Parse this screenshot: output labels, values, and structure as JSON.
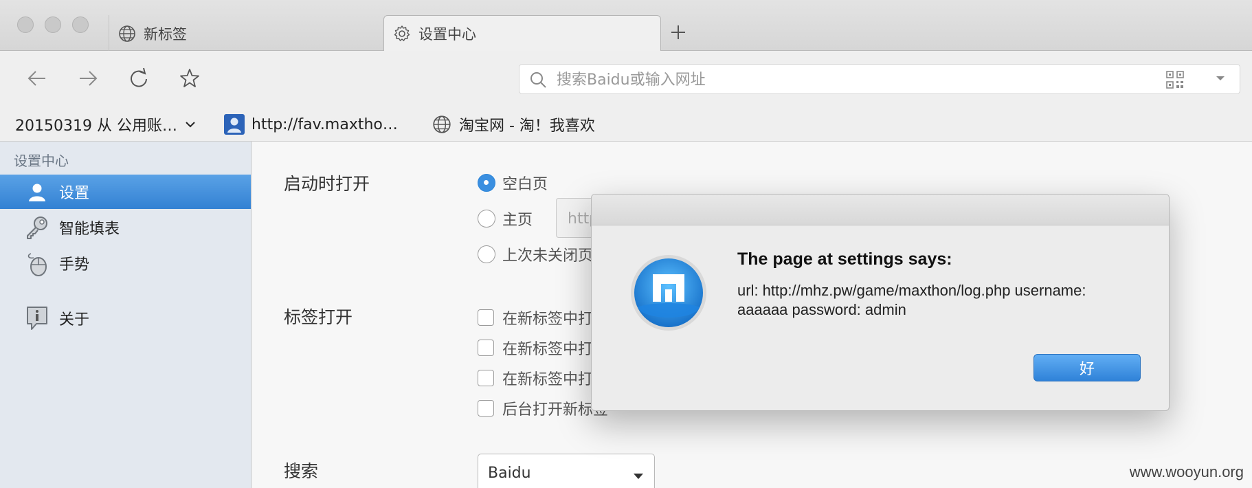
{
  "tabs": [
    {
      "label": "新标签",
      "icon": "globe-icon",
      "active": false
    },
    {
      "label": "设置中心",
      "icon": "gear-icon",
      "active": true
    }
  ],
  "toolbar": {
    "address_placeholder": "搜索Baidu或输入网址"
  },
  "bookmarks": [
    {
      "label": "20150319 从 公用账…",
      "icon": "chevron-down-icon"
    },
    {
      "label": "http://fav.maxtho…",
      "icon": "user-avatar-icon"
    },
    {
      "label": "淘宝网 - 淘！我喜欢",
      "icon": "globe-icon"
    }
  ],
  "sidebar": {
    "header": "设置中心",
    "items": [
      {
        "label": "设置",
        "icon": "user-icon",
        "active": true
      },
      {
        "label": "智能填表",
        "icon": "key-icon",
        "active": false
      },
      {
        "label": "手势",
        "icon": "mouse-icon",
        "active": false
      },
      {
        "label": "关于",
        "icon": "info-icon",
        "active": false
      }
    ]
  },
  "settings": {
    "startup": {
      "label": "启动时打开",
      "options": [
        "空白页",
        "主页",
        "上次未关闭页"
      ],
      "selected": "空白页",
      "homepage_placeholder": "http"
    },
    "tabs_open": {
      "label": "标签打开",
      "options": [
        "在新标签中打",
        "在新标签中打",
        "在新标签中打",
        "后台打开新标签"
      ]
    },
    "search": {
      "label": "搜索",
      "engine": "Baidu"
    }
  },
  "dialog": {
    "title": "The page at settings says:",
    "message": "url: http://mhz.pw/game/maxthon/log.php username: aaaaaa password: admin",
    "ok_label": "好"
  },
  "watermark": "www.wooyun.org",
  "colors": {
    "accent": "#3a8fe0",
    "sidebar_bg": "#e3e8ef",
    "dialog_bg": "#ececec"
  }
}
